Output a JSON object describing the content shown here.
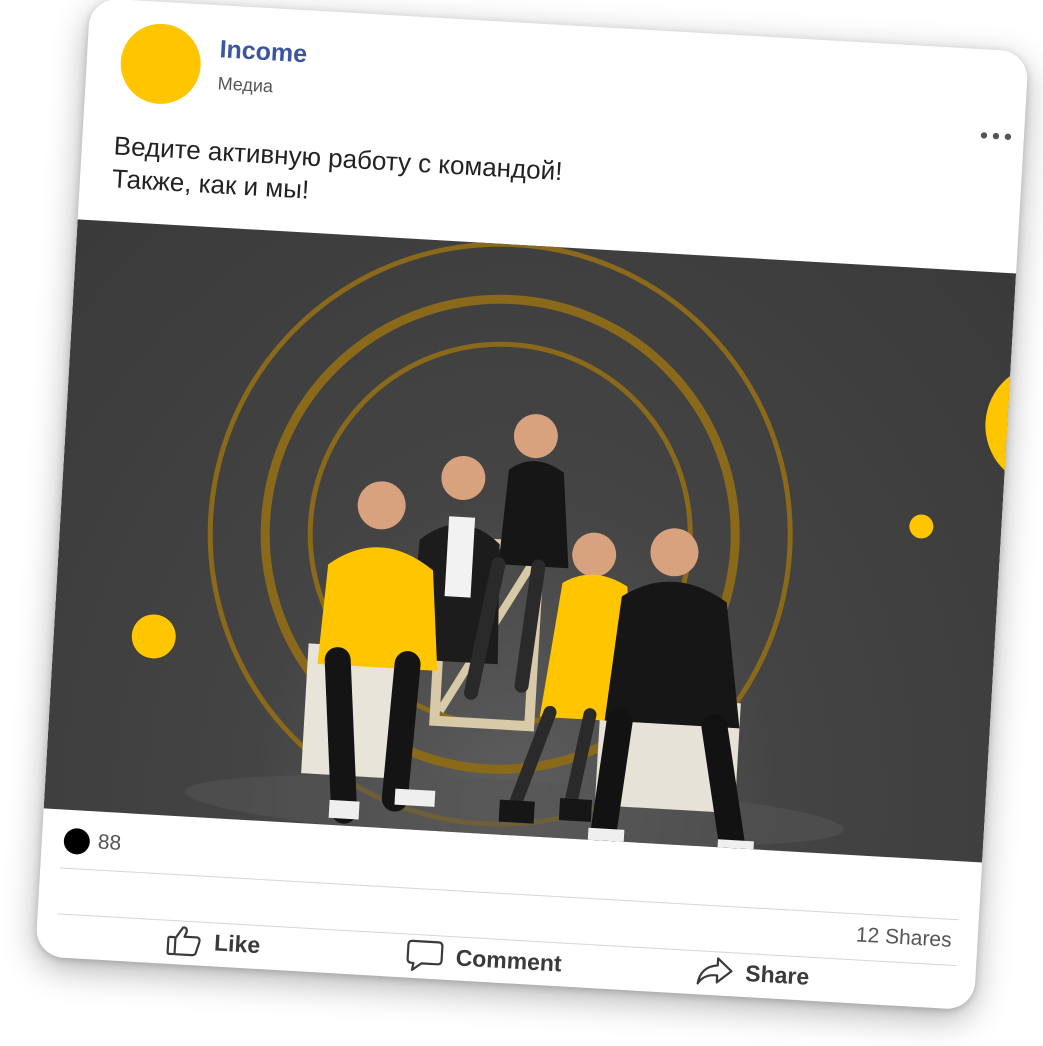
{
  "post": {
    "author": {
      "name": "Income",
      "subtitle": "Медиа"
    },
    "text_lines": [
      "Ведите активную работу с командой!",
      "Также, как и мы!"
    ],
    "image": {
      "background_color": "#3f3f3f",
      "accent_color": "#ffc600",
      "ring_color": "#8a6a1a"
    },
    "reactions_count": "88",
    "shares_label": "12 Shares",
    "actions": {
      "like": "Like",
      "comment": "Comment",
      "share": "Share"
    }
  },
  "colors": {
    "author_name": "#3b55a0",
    "avatar": "#ffc600"
  },
  "icons": {
    "more": "more-horizontal-icon",
    "like": "thumbs-up-icon",
    "comment": "comment-bubble-icon",
    "share": "share-arrow-icon"
  }
}
